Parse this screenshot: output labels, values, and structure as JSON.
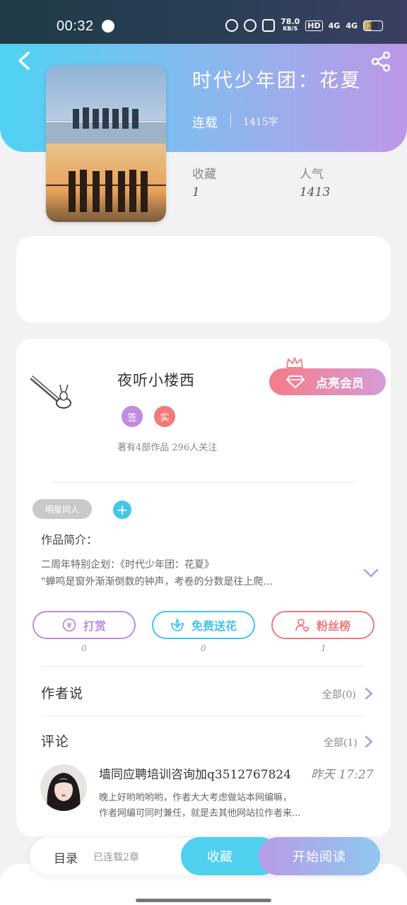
{
  "status_bar": {
    "time": "00:32",
    "net_speed_value": "78.0",
    "net_speed_unit": "KB/S",
    "hd": "HD",
    "signal1": "4G",
    "signal2": "4G",
    "battery": "38"
  },
  "header": {
    "back_icon": "chevron-left-icon",
    "share_icon": "share-icon"
  },
  "book": {
    "title": "时代少年团：花夏",
    "status": "连载",
    "word_count": "1415字",
    "stats": [
      {
        "label": "收藏",
        "value": "1"
      },
      {
        "label": "人气",
        "value": "1413"
      }
    ]
  },
  "author": {
    "name": "夜听小楼西",
    "badges": [
      {
        "text": "签",
        "color": "#c08be0"
      },
      {
        "text": "实",
        "color": "#f07a7a"
      }
    ],
    "meta": "著有4部作品 296人关注",
    "vip_button": "点亮会员"
  },
  "tags": {
    "chip": "明星同人",
    "add": "+"
  },
  "intro": {
    "label": "作品简介：",
    "line1": "二周年特别企划：《时代少年团：花夏》",
    "line2": "\"蝉鸣是窗外渐渐倒数的钟声，考卷的分数是往上爬..."
  },
  "actions": [
    {
      "label": "打赏",
      "count": "0",
      "color": "#c08be0",
      "icon": "yuan-icon"
    },
    {
      "label": "免费送花",
      "count": "0",
      "color": "#41c7ea",
      "icon": "flower-icon"
    },
    {
      "label": "粉丝榜",
      "count": "1",
      "color": "#f07a7a",
      "icon": "fan-icon"
    }
  ],
  "author_says": {
    "title": "作者说",
    "all": "全部(0)"
  },
  "comments": {
    "title": "评论",
    "all": "全部(1)",
    "items": [
      {
        "user": "墙同应聘培训咨询加q3512767824",
        "time": "昨天 17:27",
        "line1": "晚上好哟哟哟哟，作者大大考虑做站本网编嘛，",
        "line2": "作者网编可同时兼任，就是去其他网站拉作者来..."
      }
    ]
  },
  "bottom_bar": {
    "toc": "目录",
    "toc_count": "已连载2章",
    "favorite": "收藏",
    "start_reading": "开始阅读"
  }
}
